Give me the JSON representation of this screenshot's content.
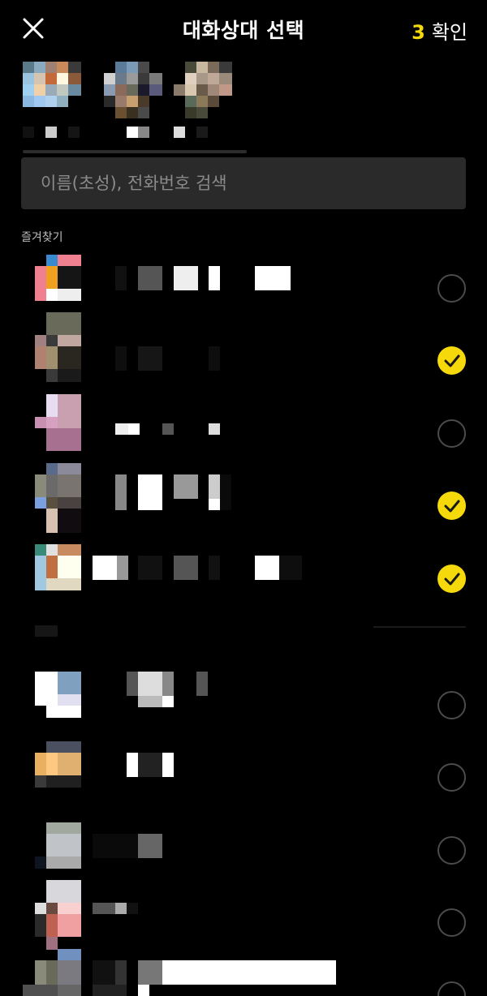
{
  "header": {
    "title": "대화상대 선택",
    "selected_count": "3",
    "confirm_label": "확인"
  },
  "search": {
    "placeholder": "이름(초성), 전화번호 검색"
  },
  "sections": {
    "favorites_label": "즐겨찾기"
  },
  "selected": [
    {
      "avatar": "blurred-avatar-1"
    },
    {
      "avatar": "blurred-avatar-2"
    },
    {
      "avatar": "blurred-avatar-3"
    }
  ],
  "favorites": [
    {
      "checked": false
    },
    {
      "checked": true
    },
    {
      "checked": false
    },
    {
      "checked": true
    },
    {
      "checked": true
    }
  ],
  "friends": [
    {
      "checked": false
    },
    {
      "checked": false
    },
    {
      "checked": false
    },
    {
      "checked": false
    },
    {
      "checked": false
    }
  ],
  "colors": {
    "accent_yellow": "#f5d90a",
    "background": "#000000",
    "search_bg": "#2a2a2a"
  }
}
